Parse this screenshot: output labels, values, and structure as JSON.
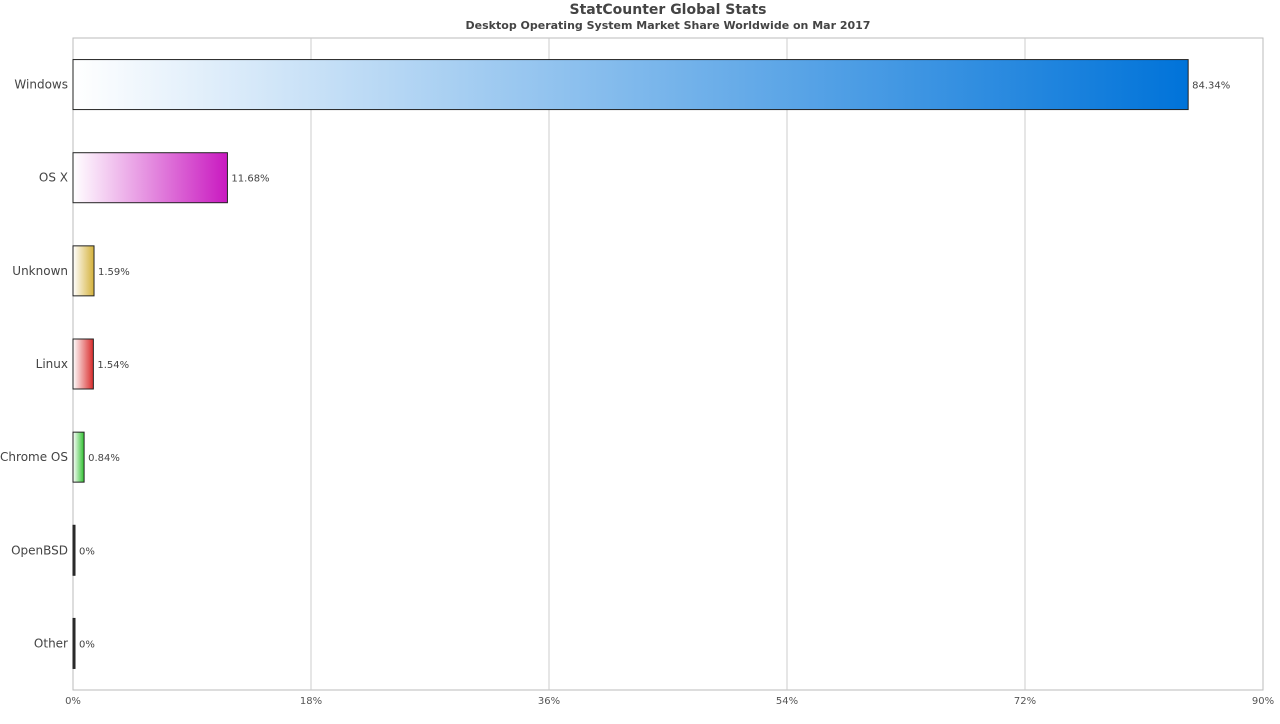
{
  "chart_data": {
    "type": "bar",
    "orientation": "horizontal",
    "title": "StatCounter Global Stats",
    "subtitle": "Desktop Operating System Market Share Worldwide on Mar 2017",
    "xlim": [
      0,
      90
    ],
    "x_ticks": [
      0,
      18,
      36,
      54,
      72,
      90
    ],
    "x_tick_labels": [
      "0%",
      "18%",
      "36%",
      "54%",
      "72%",
      "90%"
    ],
    "grid": true,
    "categories": [
      "Windows",
      "OS X",
      "Unknown",
      "Linux",
      "Chrome OS",
      "OpenBSD",
      "Other"
    ],
    "values": [
      84.34,
      11.68,
      1.59,
      1.54,
      0.84,
      0,
      0
    ],
    "value_labels": [
      "84.34%",
      "11.68%",
      "1.59%",
      "1.54%",
      "0.84%",
      "0%",
      "0%"
    ],
    "colors": [
      "#0073d9",
      "#c919c0",
      "#d4b13a",
      "#d92b2b",
      "#2fc12f",
      "#333333",
      "#333333"
    ]
  }
}
